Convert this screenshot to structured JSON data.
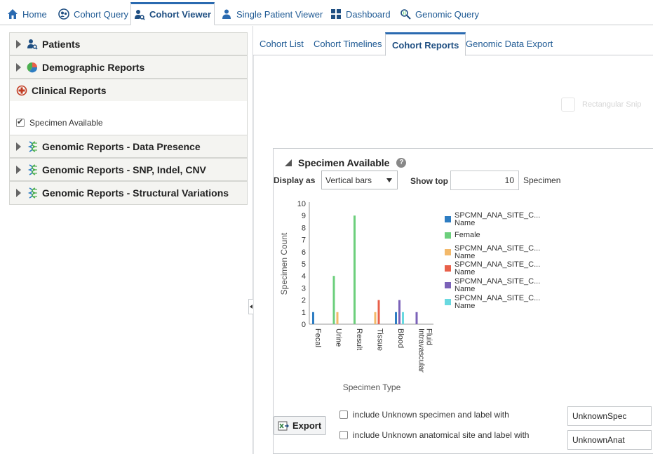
{
  "topnav": {
    "tabs": [
      {
        "label": "Home",
        "icon": "home-icon"
      },
      {
        "label": "Cohort Query",
        "icon": "users-icon"
      },
      {
        "label": "Cohort Viewer",
        "icon": "user-search-icon",
        "active": true
      },
      {
        "label": "Single Patient Viewer",
        "icon": "user-icon"
      },
      {
        "label": "Dashboard",
        "icon": "grid-icon"
      },
      {
        "label": "Genomic Query",
        "icon": "genomic-search-icon"
      }
    ]
  },
  "sidebar": {
    "sections": [
      {
        "label": "Patients",
        "icon": "patient-search-icon"
      },
      {
        "label": "Demographic Reports",
        "icon": "pie-chart-icon"
      },
      {
        "label": "Clinical Reports",
        "icon": "medical-cross-icon",
        "expanded": true
      },
      {
        "label": "Genomic Reports - Data Presence",
        "icon": "dna-icon"
      },
      {
        "label": "Genomic Reports - SNP, Indel, CNV",
        "icon": "dna-icon"
      },
      {
        "label": "Genomic Reports - Structural Variations",
        "icon": "dna-icon"
      }
    ],
    "clinical_items": [
      {
        "label": "Specimen Available",
        "checked": true
      }
    ]
  },
  "subtabs": [
    {
      "label": "Cohort List"
    },
    {
      "label": "Cohort Timelines"
    },
    {
      "label": "Cohort Reports",
      "active": true
    },
    {
      "label": "Genomic Data Export"
    }
  ],
  "ghost_overlay": {
    "label": "Rectangular Snip"
  },
  "report": {
    "title": "Specimen Available",
    "help": "?",
    "display_as_label": "Display as",
    "display_as_value": "Vertical bars",
    "show_top_label": "Show top",
    "show_top_value": "10",
    "show_top_suffix": "Specimen",
    "export_label": "Export",
    "unknown_specimen_label": "include Unknown specimen and label with",
    "unknown_specimen_value": "UnknownSpec",
    "unknown_anat_label": "include Unknown anatomical site and label with",
    "unknown_anat_value": "UnknownAnat"
  },
  "chart_data": {
    "type": "bar",
    "title": "",
    "xlabel": "Specimen Type",
    "ylabel": "Specimen Count",
    "ylim": [
      0,
      10
    ],
    "yticks": [
      "0",
      "1",
      "2",
      "3",
      "4",
      "5",
      "6",
      "7",
      "8",
      "9",
      "10"
    ],
    "categories": [
      "Fecal",
      "Urine",
      "Result",
      "Tissue",
      "Blood",
      "Intravascular Fluid"
    ],
    "series": [
      {
        "name": "SPCMN_ANA_SITE_C... Name",
        "color": "#2e7dc2",
        "values": [
          1,
          0,
          0,
          0,
          1,
          0
        ]
      },
      {
        "name": "Female",
        "color": "#6ccf7c",
        "values": [
          0,
          4,
          9,
          0,
          0,
          0
        ]
      },
      {
        "name": "SPCMN_ANA_SITE_C... Name",
        "color": "#f3b96a",
        "values": [
          0,
          1,
          0,
          1,
          0,
          0
        ]
      },
      {
        "name": "SPCMN_ANA_SITE_C... Name",
        "color": "#e8604a",
        "values": [
          0,
          0,
          0,
          2,
          0,
          0
        ]
      },
      {
        "name": "SPCMN_ANA_SITE_C... Name",
        "color": "#7b62b8",
        "values": [
          0,
          0,
          0,
          0,
          2,
          1
        ]
      },
      {
        "name": "SPCMN_ANA_SITE_C... Name",
        "color": "#69d9e0",
        "values": [
          0,
          0,
          0,
          0,
          1,
          0
        ]
      }
    ],
    "legend_position": "right"
  }
}
